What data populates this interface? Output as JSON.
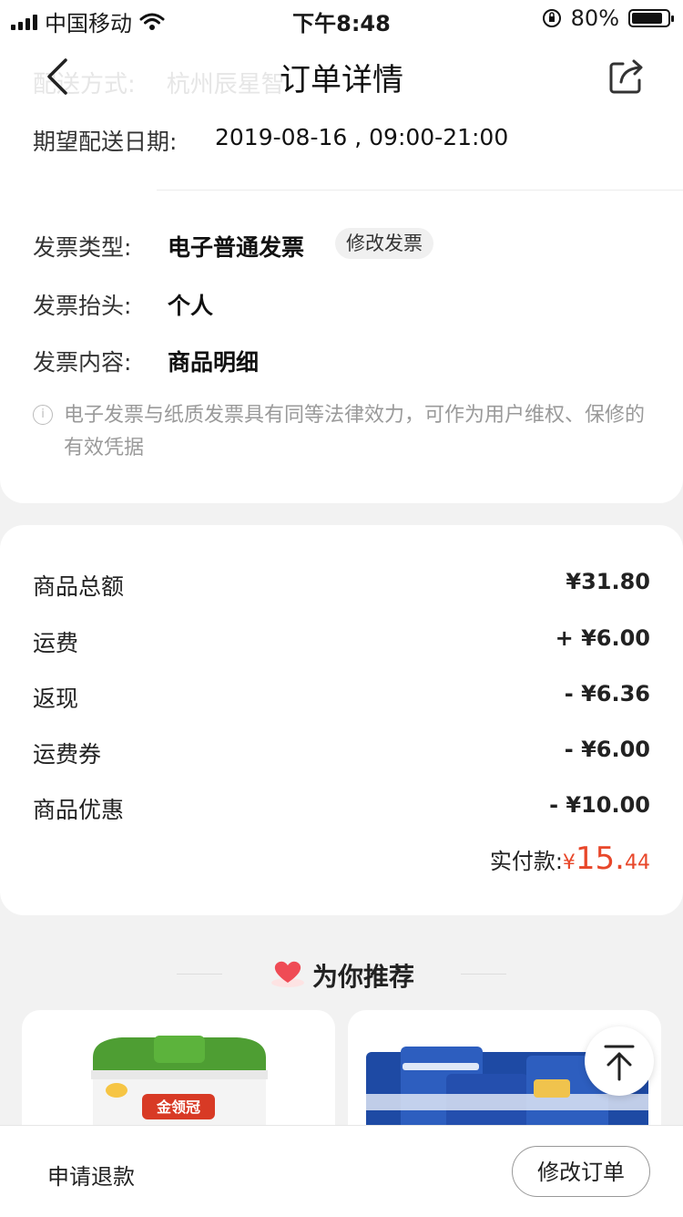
{
  "status_bar": {
    "carrier": "中国移动",
    "time": "下午8:48",
    "battery": "80%"
  },
  "nav": {
    "title": "订单详情",
    "ghost_label": "配送方式:",
    "ghost_value": "杭州辰星智"
  },
  "delivery": {
    "label": "期望配送日期:",
    "value": "2019-08-16 , 09:00-21:00"
  },
  "invoice": {
    "type_label": "发票类型:",
    "type_value": "电子普通发票",
    "edit_button": "修改发票",
    "header_label": "发票抬头:",
    "header_value": "个人",
    "content_label": "发票内容:",
    "content_value": "商品明细",
    "note": "电子发票与纸质发票具有同等法律效力，可作为用户维权、保修的有效凭据"
  },
  "price": {
    "rows": [
      {
        "label": "商品总额",
        "value": "¥31.80"
      },
      {
        "label": "运费",
        "value": "+ ¥6.00"
      },
      {
        "label": "返现",
        "value": "- ¥6.36"
      },
      {
        "label": "运费券",
        "value": "- ¥6.00"
      },
      {
        "label": "商品优惠",
        "value": "- ¥10.00"
      }
    ],
    "paid_label": "实付款:",
    "paid_symbol": "¥",
    "paid_int": "15.",
    "paid_dec": "44"
  },
  "recommend": {
    "title": "为你推荐",
    "product1_brand": "金领冠"
  },
  "bottom": {
    "refund": "申请退款",
    "edit_order": "修改订单"
  }
}
